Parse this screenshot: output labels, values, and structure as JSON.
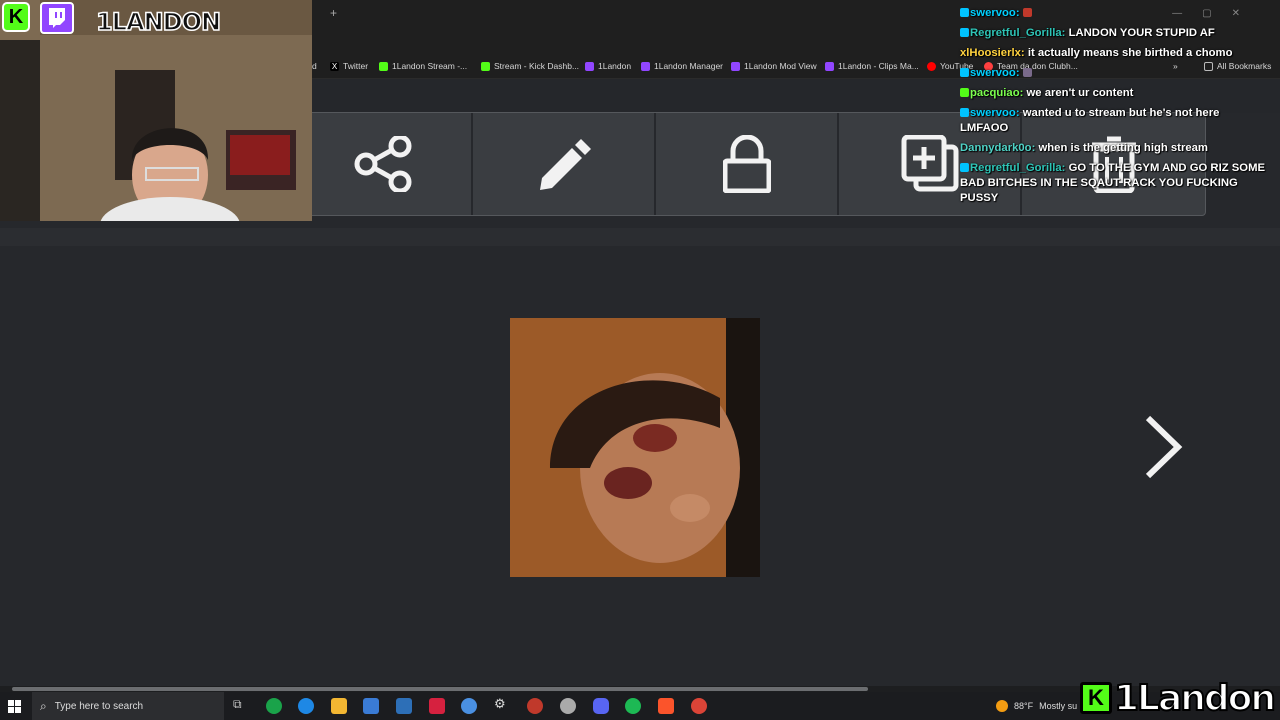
{
  "browser": {
    "new_tab": "+",
    "bookmarks": [
      {
        "label": "d",
        "color": "#1f1f1f"
      },
      {
        "label": "Twitter",
        "color": "#000000"
      },
      {
        "label": "1Landon Stream -...",
        "color": "#53fc18"
      },
      {
        "label": "Stream - Kick Dashb...",
        "color": "#53fc18"
      },
      {
        "label": "1Landon",
        "color": "#9146ff"
      },
      {
        "label": "1Landon Manager",
        "color": "#9146ff"
      },
      {
        "label": "1Landon Mod View",
        "color": "#9146ff"
      },
      {
        "label": "1Landon - Clips Ma...",
        "color": "#9146ff"
      },
      {
        "label": "YouTube",
        "color": "#ff0000"
      },
      {
        "label": "Team da don Clubh...",
        "color": "#ff4040"
      }
    ],
    "more_bookmarks": "»",
    "all_bookmarks": "All Bookmarks"
  },
  "toolbar": {
    "buttons": [
      {
        "name": "share",
        "icon": "share-icon"
      },
      {
        "name": "edit",
        "icon": "pencil-icon"
      },
      {
        "name": "lock",
        "icon": "lock-icon"
      },
      {
        "name": "add-to-collection",
        "icon": "add-copy-icon"
      },
      {
        "name": "delete",
        "icon": "trash-icon"
      }
    ]
  },
  "webcam": {
    "overlay_name": "1LANDON"
  },
  "chat": [
    {
      "user": "swervoo:",
      "user_color": "#00d1ff",
      "text": ""
    },
    {
      "user": "Regretful_Gorilla:",
      "user_color": "#2ec4b6",
      "text": "LANDON YOUR STUPID AF"
    },
    {
      "user": "xlHoosierlx:",
      "user_color": "#ffd23f",
      "text": "it actually means she birthed a chomo"
    },
    {
      "user": "swervoo:",
      "user_color": "#00d1ff",
      "text": ""
    },
    {
      "user": "pacquiao:",
      "user_color": "#7cff4f",
      "text": "we aren't ur content"
    },
    {
      "user": "swervoo:",
      "user_color": "#00d1ff",
      "text": "wanted u to stream but he's not here LMFAOO"
    },
    {
      "user": "Dannydark0o:",
      "user_color": "#4fd1c5",
      "text": "when is the getting high stream"
    },
    {
      "user": "Regretful_Gorilla:",
      "user_color": "#2ec4b6",
      "text": "GO TO THE GYM AND GO RIZ SOME BAD BITCHES IN THE SQAUT RACK YOU FUCKING PUSSY"
    }
  ],
  "taskbar": {
    "search_placeholder": "Type here to search",
    "weather_temp": "88°F",
    "weather_desc": "Mostly su"
  },
  "brand": {
    "k": "K",
    "name": "1Landon"
  },
  "colors": {
    "kick_green": "#53fc18",
    "twitch_purple": "#9146ff",
    "page_bg": "#26282c",
    "toolbar_bg": "#3a3d41"
  }
}
